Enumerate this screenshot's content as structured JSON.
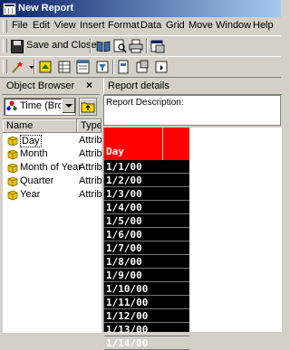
{
  "window": {
    "title": "New Report"
  },
  "menu": [
    "File",
    "Edit",
    "View",
    "Insert",
    "Format",
    "Data",
    "Grid",
    "Move",
    "Window",
    "Help"
  ],
  "toolbar": {
    "save_close_label": "Save and Close"
  },
  "object_browser": {
    "title": "Object Browser",
    "close_glyph": "×",
    "selected_folder": "Time (Bro",
    "columns": [
      "Name",
      "Type"
    ],
    "items": [
      {
        "name": "Day",
        "type": "Attrib"
      },
      {
        "name": "Month",
        "type": "Attrib"
      },
      {
        "name": "Month of Year",
        "type": "Attrib"
      },
      {
        "name": "Quarter",
        "type": "Attrib"
      },
      {
        "name": "Year",
        "type": "Attrib"
      }
    ]
  },
  "report": {
    "title": "Report details",
    "description_label": "Report Description:",
    "grid_header": "Day",
    "rows": [
      "1/1/00",
      "1/2/00",
      "1/3/00",
      "1/4/00",
      "1/5/00",
      "1/6/00",
      "1/7/00",
      "1/8/00",
      "1/9/00",
      "1/10/00",
      "1/11/00",
      "1/12/00",
      "1/13/00",
      "1/14/00"
    ]
  },
  "colors": {
    "grid_header": "#ff0000",
    "grid_body": "#000000",
    "title_bar": "#0a246a"
  }
}
